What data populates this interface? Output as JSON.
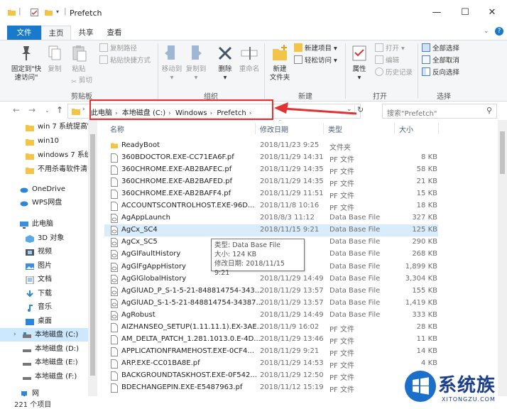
{
  "window": {
    "title": "Prefetch"
  },
  "ribbon_tabs": [
    "文件",
    "主页",
    "共享",
    "查看"
  ],
  "ribbon": {
    "pin_label": "固定到\"快\n速访问\"",
    "copy_label": "复制",
    "paste_label": "粘贴",
    "copy_path": "复制路径",
    "paste_shortcut": "粘贴快捷方式",
    "cut": "剪切",
    "clipboard_group": "剪贴板",
    "move_to": "移动到",
    "copy_to": "复制到",
    "delete": "删除",
    "rename": "重命名",
    "organize_group": "组织",
    "new_folder": "新建\n文件夹",
    "new_item": "新建项目",
    "easy_access": "轻松访问",
    "new_group": "新建",
    "properties": "属性",
    "open": "打开",
    "edit": "编辑",
    "history": "历史记录",
    "open_group": "打开",
    "select_all": "全部选择",
    "select_none": "全部取消",
    "invert_selection": "反向选择",
    "select_group": "选择"
  },
  "breadcrumb": [
    "此电脑",
    "本地磁盘 (C:)",
    "Windows",
    "Prefetch"
  ],
  "search_placeholder": "搜索\"Prefetch\"",
  "nav": [
    {
      "label": "win 7 系统提高\\",
      "icon": "folder"
    },
    {
      "label": "win10",
      "icon": "folder"
    },
    {
      "label": "windows 7 系统",
      "icon": "folder"
    },
    {
      "label": "不用杀毒软件清",
      "icon": "folder"
    },
    {
      "label": "OneDrive",
      "icon": "cloud"
    },
    {
      "label": "WPS网盘",
      "icon": "cloud"
    },
    {
      "label": "此电脑",
      "icon": "pc"
    },
    {
      "label": "3D 对象",
      "icon": "cube"
    },
    {
      "label": "视频",
      "icon": "video"
    },
    {
      "label": "图片",
      "icon": "picture"
    },
    {
      "label": "文档",
      "icon": "document"
    },
    {
      "label": "下载",
      "icon": "download"
    },
    {
      "label": "音乐",
      "icon": "music"
    },
    {
      "label": "桌面",
      "icon": "desktop"
    },
    {
      "label": "本地磁盘 (C:)",
      "icon": "drive-c"
    },
    {
      "label": "本地磁盘 (D:)",
      "icon": "drive"
    },
    {
      "label": "本地磁盘 (E:)",
      "icon": "drive"
    },
    {
      "label": "本地磁盘 (F:)",
      "icon": "drive"
    },
    {
      "label": "网",
      "icon": "network"
    }
  ],
  "columns": [
    "名称",
    "修改日期",
    "类型",
    "大小"
  ],
  "files": [
    {
      "name": "ReadyBoot",
      "date": "2018/11/23 9:25",
      "type": "文件夹",
      "size": "",
      "icon": "folder"
    },
    {
      "name": "360BDOCTOR.EXE-CC71EA6F.pf",
      "date": "2018/11/29 14:31",
      "type": "PF 文件",
      "size": "8 KB",
      "icon": "file"
    },
    {
      "name": "360CHROME.EXE-AB2BAFEC.pf",
      "date": "2018/11/29 14:35",
      "type": "PF 文件",
      "size": "58 KB",
      "icon": "file"
    },
    {
      "name": "360CHROME.EXE-AB2BAFED.pf",
      "date": "2018/11/29 14:35",
      "type": "PF 文件",
      "size": "21 KB",
      "icon": "file"
    },
    {
      "name": "360CHROME.EXE-AB2BAFF4.pf",
      "date": "2018/11/29 11:51",
      "type": "PF 文件",
      "size": "15 KB",
      "icon": "file"
    },
    {
      "name": "ACCOUNTSCONTROLHOST.EXE-96D...",
      "date": "2018/11/8 10:16",
      "type": "PF 文件",
      "size": "18 KB",
      "icon": "file"
    },
    {
      "name": "AgAppLaunch",
      "date": "2018/8/3 11:12",
      "type": "Data Base File",
      "size": "327 KB",
      "icon": "db"
    },
    {
      "name": "AgCx_SC4",
      "date": "2018/11/15 9:21",
      "type": "Data Base File",
      "size": "125 KB",
      "icon": "db"
    },
    {
      "name": "AgCx_SC5",
      "date": "20",
      "type": "Data Base File",
      "size": "290 KB",
      "icon": "db"
    },
    {
      "name": "AgGlFaultHistory",
      "date": "49",
      "type": "Data Base File",
      "size": "268 KB",
      "icon": "db"
    },
    {
      "name": "AgGlFgAppHistory",
      "date": "49",
      "type": "Data Base File",
      "size": "1,899 KB",
      "icon": "db"
    },
    {
      "name": "AgGlGlobalHistory",
      "date": "2018/11/29 14:49",
      "type": "Data Base File",
      "size": "3,304 KB",
      "icon": "db"
    },
    {
      "name": "AgGlUAD_P_S-1-5-21-848814754-343...",
      "date": "2018/11/29 13:57",
      "type": "Data Base File",
      "size": "155 KB",
      "icon": "db"
    },
    {
      "name": "AgGlUAD_S-1-5-21-848814754-34387...",
      "date": "2018/11/29 13:57",
      "type": "Data Base File",
      "size": "1,419 KB",
      "icon": "db"
    },
    {
      "name": "AgRobust",
      "date": "2018/11/29 14:49",
      "type": "Data Base File",
      "size": "333 KB",
      "icon": "db"
    },
    {
      "name": "AIZHANSEO_SETUP(1.11.11.1).EX-3AE...",
      "date": "2018/11/9 16:02",
      "type": "PF 文件",
      "size": "28 KB",
      "icon": "file"
    },
    {
      "name": "AM_DELTA_PATCH_1.281.1013.0.E-4D...",
      "date": "2018/11/29 13:46",
      "type": "PF 文件",
      "size": "11 KB",
      "icon": "file"
    },
    {
      "name": "APPLICATIONFRAMEHOST.EXE-0CF4...",
      "date": "2018/11/29 9:21",
      "type": "PF 文件",
      "size": "14 KB",
      "icon": "file"
    },
    {
      "name": "ARP.EXE-CC01BA8E.pf",
      "date": "2018/11/29 14:53",
      "type": "PF 文件",
      "size": "4 KB",
      "icon": "file"
    },
    {
      "name": "BACKGROUNDTASKHOST.EXE-0F542...",
      "date": "2018/11/29 12:50",
      "type": "PF 文件",
      "size": "",
      "icon": "file"
    },
    {
      "name": "BDECHANGEPIN.EXE-E5487963.pf",
      "date": "2018/11/12 15:19",
      "type": "PF 文件",
      "size": "",
      "icon": "file"
    }
  ],
  "tooltip": {
    "line1": "类型: Data Base File",
    "line2": "大小: 124 KB",
    "line3": "修改日期: 2018/11/15 9:21"
  },
  "status": {
    "count": "221 个项目"
  },
  "watermark": {
    "text": "系统族",
    "sub": "XITONGZU.COM"
  },
  "colors": {
    "accent": "#1979ca",
    "highlight": "#e23232",
    "selection": "#cce8ff"
  }
}
